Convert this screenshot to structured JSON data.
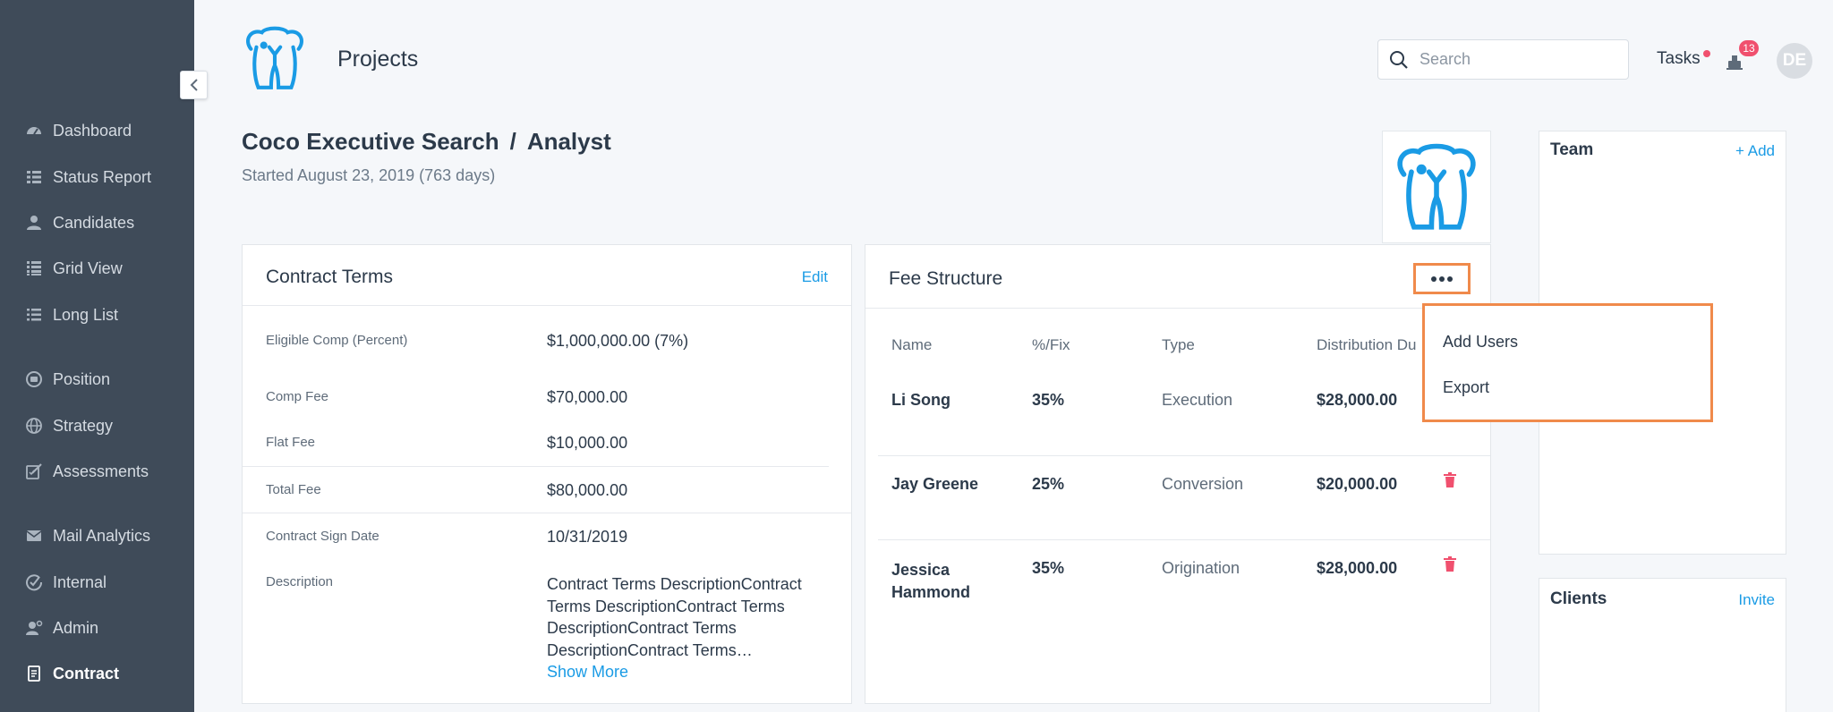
{
  "app": {
    "page_title": "Projects"
  },
  "sidebar": {
    "items": [
      {
        "label": "Dashboard",
        "icon": "dashboard-icon"
      },
      {
        "label": "Status Report",
        "icon": "status-report-icon"
      },
      {
        "label": "Candidates",
        "icon": "person-icon"
      },
      {
        "label": "Grid View",
        "icon": "grid-icon"
      },
      {
        "label": "Long List",
        "icon": "list-icon"
      },
      {
        "label": "Position",
        "icon": "position-icon"
      },
      {
        "label": "Strategy",
        "icon": "globe-icon"
      },
      {
        "label": "Assessments",
        "icon": "edit-check-icon"
      },
      {
        "label": "Mail Analytics",
        "icon": "mail-icon"
      },
      {
        "label": "Internal",
        "icon": "internal-icon"
      },
      {
        "label": "Admin",
        "icon": "admin-icon"
      },
      {
        "label": "Contract",
        "icon": "document-icon",
        "active": true
      }
    ]
  },
  "header": {
    "search": {
      "placeholder": "Search",
      "value": ""
    },
    "tasks_label": "Tasks",
    "notification_count": "13",
    "avatar_initials": "DE"
  },
  "project": {
    "company": "Coco Executive Search",
    "separator": "/",
    "role": "Analyst",
    "started": "Started August 23, 2019 (763 days)"
  },
  "contract_terms": {
    "title": "Contract Terms",
    "edit_label": "Edit",
    "rows": [
      {
        "label": "Eligible Comp (Percent)",
        "value": "$1,000,000.00 (7%)"
      },
      {
        "label": "Comp Fee",
        "value": "$70,000.00"
      },
      {
        "label": "Flat Fee",
        "value": "$10,000.00"
      },
      {
        "label": "Total Fee",
        "value": "$80,000.00"
      },
      {
        "label": "Contract Sign Date",
        "value": "10/31/2019"
      },
      {
        "label": "Description",
        "value": "Contract Terms DescriptionContract Terms DescriptionContract Terms DescriptionContract Terms DescriptionContract Terms…"
      }
    ],
    "description_lines": [
      "Contract Terms DescriptionContract",
      "Terms DescriptionContract Terms",
      "DescriptionContract Terms",
      "DescriptionContract Terms…"
    ],
    "show_more": "Show More"
  },
  "fee_structure": {
    "title": "Fee Structure",
    "columns": [
      "Name",
      "%/Fix",
      "Type",
      "Distribution Du"
    ],
    "rows": [
      {
        "name": "Li Song",
        "pct": "35%",
        "type": "Execution",
        "amount": "$28,000.00"
      },
      {
        "name": "Jay Greene",
        "pct": "25%",
        "type": "Conversion",
        "amount": "$20,000.00"
      },
      {
        "name_line1": "Jessica",
        "name_line2": "Hammond",
        "pct": "35%",
        "type": "Origination",
        "amount": "$28,000.00"
      }
    ],
    "menu": [
      "Add Users",
      "Export"
    ],
    "colors": {
      "highlight": "#f08a4b",
      "delete": "#f0506e"
    }
  },
  "team": {
    "title": "Team",
    "add_label": "+ Add"
  },
  "clients": {
    "title": "Clients",
    "invite_label": "Invite"
  },
  "colors": {
    "sidebar": "#3f4b59",
    "accent": "#1a9be5",
    "logo": "#1a9be5"
  }
}
